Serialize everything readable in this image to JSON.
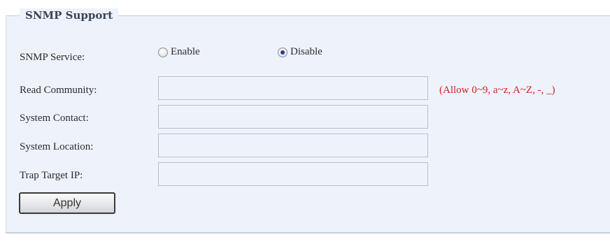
{
  "section": {
    "title": "SNMP Support"
  },
  "snmp_service": {
    "label": "SNMP Service:",
    "options": [
      {
        "label": "Enable",
        "checked": false
      },
      {
        "label": "Disable",
        "checked": true
      }
    ]
  },
  "fields": {
    "read_community": {
      "label": "Read Community:",
      "value": "",
      "hint": "(Allow 0~9, a~z, A~Z, -, _)"
    },
    "system_contact": {
      "label": "System Contact:",
      "value": ""
    },
    "system_location": {
      "label": "System Location:",
      "value": ""
    },
    "trap_target_ip": {
      "label": "Trap Target IP:",
      "value": ""
    }
  },
  "actions": {
    "apply_label": "Apply"
  },
  "colors": {
    "panel_bg": "#eef2fb",
    "hint_red": "#cc2222",
    "radio_dot": "#1f3f8a"
  }
}
